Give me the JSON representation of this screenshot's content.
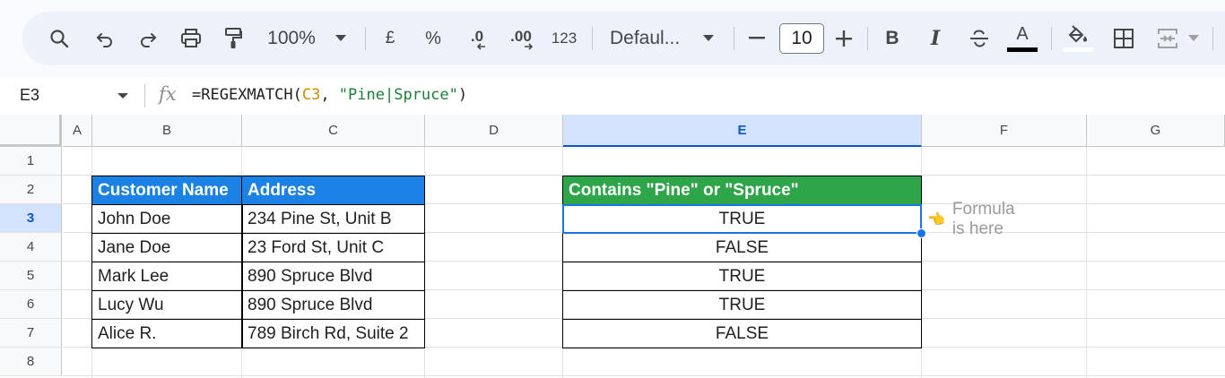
{
  "toolbar": {
    "zoom": "100%",
    "currency": "£",
    "percent": "%",
    "dec_decrease": ".0",
    "dec_increase": ".00",
    "number_format": "123",
    "font": "Defaul...",
    "font_size": "10",
    "bold": "B",
    "italic": "I",
    "text_color_letter": "A",
    "colors": {
      "accent": "#0b57d0",
      "text_color_bar": "#000000",
      "fill_bar": "#ffffff"
    }
  },
  "formula_bar": {
    "name_box": "E3",
    "fx": "fx",
    "formula_prefix": "=REGEXMATCH(",
    "formula_ref": "C3",
    "formula_sep": ", ",
    "formula_str": "\"Pine|Spruce\"",
    "formula_suffix": ")"
  },
  "grid": {
    "columns": [
      "A",
      "B",
      "C",
      "D",
      "E",
      "F",
      "G"
    ],
    "rows": [
      "1",
      "2",
      "3",
      "4",
      "5",
      "6",
      "7",
      "8"
    ],
    "selected_cell": "E3"
  },
  "table": {
    "headers": [
      "Customer Name",
      "Address"
    ],
    "rows": [
      [
        "John Doe",
        "234 Pine St, Unit B"
      ],
      [
        "Jane Doe",
        "23 Ford St, Unit C"
      ],
      [
        "Mark Lee",
        "890 Spruce Blvd"
      ],
      [
        "Lucy Wu",
        "890 Spruce Blvd"
      ],
      [
        "Alice R.",
        "789 Birch Rd, Suite 2"
      ]
    ],
    "header_color": "#1b81e5"
  },
  "result": {
    "header": "Contains \"Pine\" or \"Spruce\"",
    "values": [
      "TRUE",
      "FALSE",
      "TRUE",
      "TRUE",
      "FALSE"
    ],
    "header_color": "#2da548"
  },
  "note": {
    "icon": "pointing-hand-icon",
    "glyph": "👈",
    "text": "Formula is here"
  }
}
